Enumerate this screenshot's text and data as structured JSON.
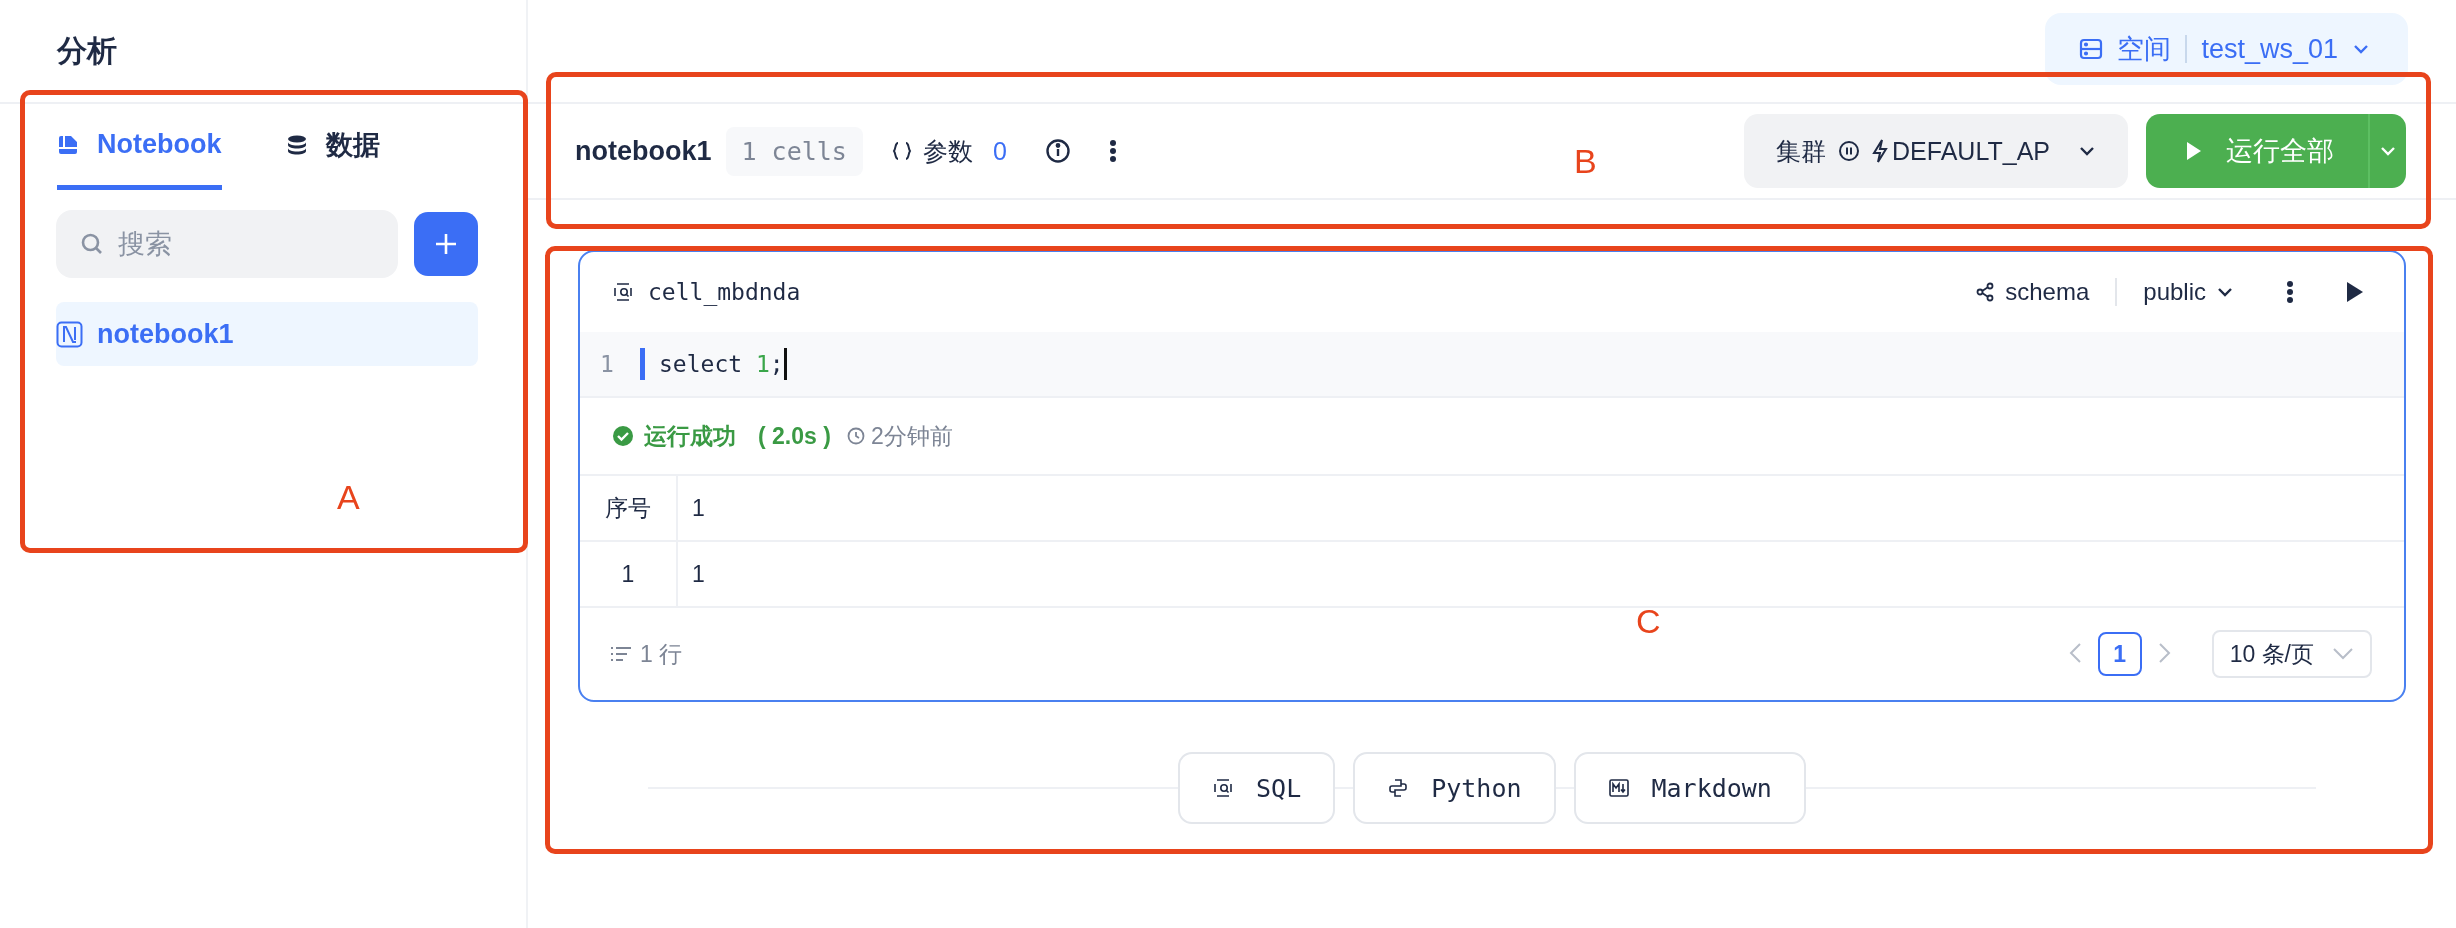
{
  "page": {
    "title": "分析"
  },
  "workspace": {
    "label": "空间",
    "value": "test_ws_01"
  },
  "sidebar": {
    "tabs": [
      {
        "label": "Notebook",
        "selected": true,
        "kind": "notebook"
      },
      {
        "label": "数据",
        "selected": false,
        "kind": "data"
      }
    ],
    "search": {
      "placeholder": "搜索"
    },
    "items": [
      {
        "label": "notebook1",
        "selected": true
      }
    ]
  },
  "toolbar": {
    "name": "notebook1",
    "cells": "1 cells",
    "params_label": "参数",
    "params_count": "0",
    "cluster_label": "集群",
    "cluster_value": "DEFAULT_AP",
    "run_button": "运行全部"
  },
  "cell": {
    "name": "cell_mbdnda",
    "kind": "sql",
    "schema_label": "schema",
    "schema_value": "public",
    "code": [
      {
        "number": "1",
        "tokens": [
          {
            "text": "select ",
            "kind": "keyword"
          },
          {
            "text": "1",
            "kind": "number"
          },
          {
            "text": ";",
            "kind": "punct"
          }
        ]
      }
    ],
    "status": {
      "kind": "success",
      "text": "运行成功",
      "duration": "( 2.0s )",
      "time": "2分钟前"
    },
    "table": {
      "columns": [
        "序号",
        "1"
      ],
      "rows": [
        [
          "1",
          "1"
        ]
      ]
    },
    "footer": {
      "row_count": "1 行",
      "page": "1",
      "page_size": "10 条/页"
    }
  },
  "add_buttons": [
    {
      "label": "SQL",
      "kind": "sql"
    },
    {
      "label": "Python",
      "kind": "python"
    },
    {
      "label": "Markdown",
      "kind": "markdown"
    }
  ],
  "annotations": [
    {
      "label": "A"
    },
    {
      "label": "B"
    },
    {
      "label": "C"
    }
  ]
}
